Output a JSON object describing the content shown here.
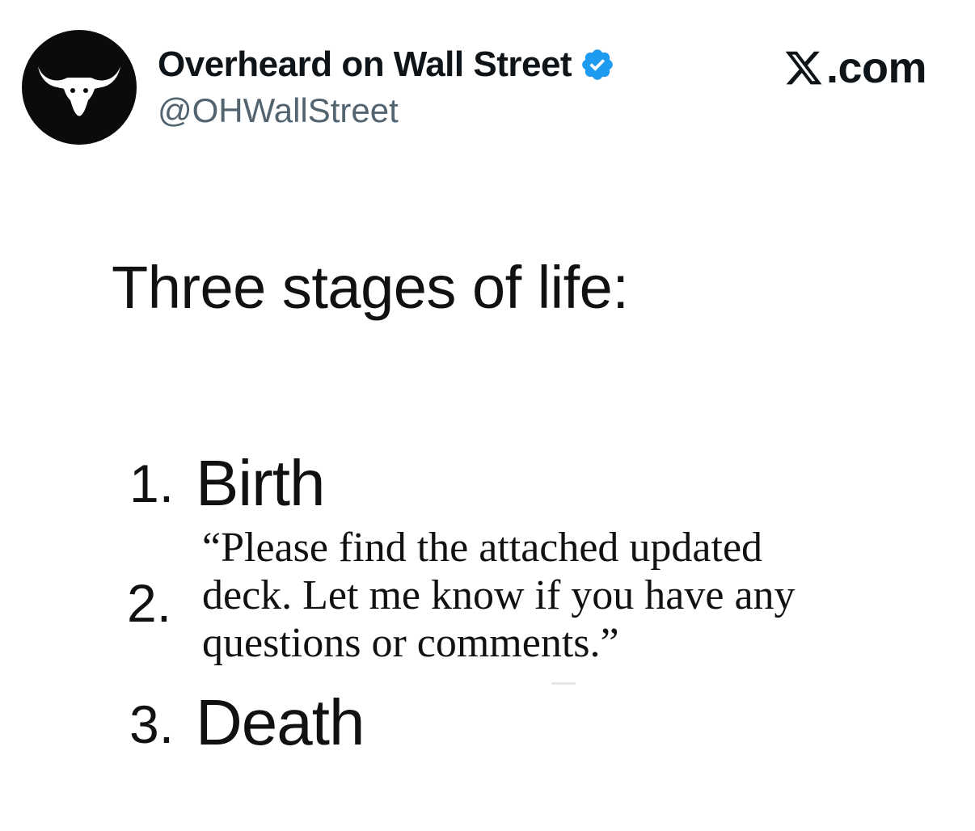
{
  "author": {
    "display_name": "Overheard on Wall Street",
    "handle": "@OHWallStreet",
    "avatar_icon": "longhorn-bull-icon",
    "verified_icon": "verified-badge-icon",
    "verified_color": "#1d9bf0"
  },
  "brand": {
    "icon": "x-logo-icon",
    "text": ".com"
  },
  "meme": {
    "title": "Three stages of life:",
    "stages": [
      {
        "number": "1.",
        "label": "Birth"
      },
      {
        "number": "2.",
        "quote_lines": [
          "“Please find the attached updated",
          "deck. Let me know if you have any",
          "questions or comments.”"
        ]
      },
      {
        "number": "3.",
        "label": "Death"
      }
    ]
  },
  "colors": {
    "text": "#0f1419",
    "handle": "#536471",
    "avatar_bg": "#0b0b0b"
  }
}
